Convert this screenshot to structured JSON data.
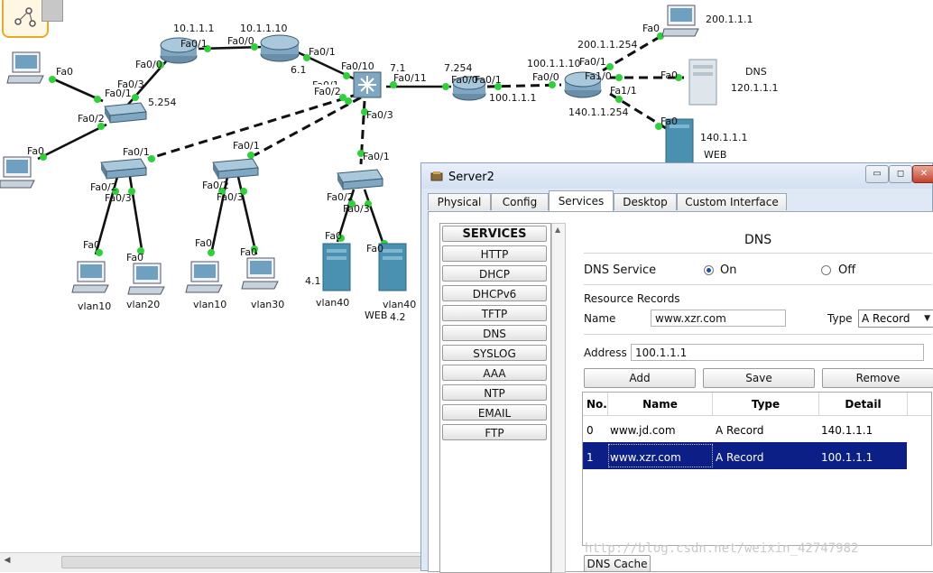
{
  "topology": {
    "labels": {
      "r1_ip": "10.1.1.1",
      "r2_ip": "10.1.1.10",
      "r1_fa01": "Fa0/1",
      "r2_fa00": "Fa0/0",
      "r1_fa00": "Fa0/0",
      "r2_fa01": "Fa0/1",
      "r2_sub": "6.1",
      "pc1_fa0": "Fa0",
      "sw1_fa01": "Fa0/1",
      "sw1_fa03": "Fa0/3",
      "sw1_ip": "5.254",
      "sw1_fa02": "Fa0/2",
      "pc2_fa0": "Fa0",
      "ms_fa010": "Fa0/10",
      "ms_ip": "7.1",
      "ms_fa011": "Fa0/11",
      "ms_fa02": "Fa0/2",
      "ms_fa01": "Fa0/1",
      "ms_fa03": "Fa0/3",
      "ra_ip": "7.254",
      "ra_fa0": "Fa0/0",
      "ra_fa01": "Fa0/1",
      "ra_ip2": "100.1.1.1",
      "rb_ip": "100.1.1.10",
      "rb_fa00": "Fa0/0",
      "rb_fa01": "Fa0/1",
      "rb_fa10": "Fa1/0",
      "rb_fa11": "Fa1/1",
      "rb_ip200": "200.1.1.254",
      "rb_ip140": "140.1.1.254",
      "pc200_fa0": "Fa0",
      "pc200_ip": "200.1.1.1",
      "dns_fa0": "Fa0",
      "dns_name": "DNS",
      "dns_ip": "120.1.1.1",
      "web_fa0": "Fa0",
      "web_ip": "140.1.1.1",
      "web_name": "WEB",
      "swa_fa01": "Fa0/1",
      "swa_fa02": "Fa0/2",
      "swa_fa03": "Fa0/3",
      "swb_fa01": "Fa0/1",
      "swb_fa02": "Fa0/2",
      "swb_fa03": "Fa0/3",
      "swc_fa01": "Fa0/1",
      "swc_fa02": "Fa0/2",
      "swc_fa03": "Fa0/3",
      "pa_fa0": "Fa0",
      "pa_name": "vlan10",
      "pb_fa0": "Fa0",
      "pb_name": "vlan20",
      "pc_fa0": "Fa0",
      "pc_name": "vlan10",
      "pd_fa0": "Fa0",
      "pd_name": "vlan30",
      "s1_fa0": "Fa0",
      "s1_ip": "4.1",
      "s1_name": "vlan40",
      "s2_fa0": "Fa0",
      "s2_name": "vlan40",
      "s2_web": "WEB",
      "s2_ip": "4.2"
    }
  },
  "window": {
    "title": "Server2",
    "controls": {
      "minimize": "▭",
      "maximize": "◻",
      "close": "✕"
    },
    "tabs": [
      "Physical",
      "Config",
      "Services",
      "Desktop",
      "Custom Interface"
    ],
    "active_tab": "Services",
    "services": [
      "SERVICES",
      "HTTP",
      "DHCP",
      "DHCPv6",
      "TFTP",
      "DNS",
      "SYSLOG",
      "AAA",
      "NTP",
      "EMAIL",
      "FTP"
    ],
    "dns": {
      "heading": "DNS",
      "service_label": "DNS Service",
      "on_label": "On",
      "off_label": "Off",
      "resource_records_label": "Resource Records",
      "name_label": "Name",
      "name_value": "www.xzr.com",
      "type_label": "Type",
      "type_value": "A Record",
      "address_label": "Address",
      "address_value": "100.1.1.1",
      "add_button": "Add",
      "save_button": "Save",
      "remove_button": "Remove",
      "table": {
        "headers": [
          "No.",
          "Name",
          "Type",
          "Detail"
        ],
        "rows": [
          [
            "0",
            "www.jd.com",
            "A Record",
            "140.1.1.1"
          ],
          [
            "1",
            "www.xzr.com",
            "A Record",
            "100.1.1.1"
          ]
        ],
        "selected_row": 1
      },
      "dns_cache_button": "DNS Cache"
    }
  },
  "watermark": "http://blog.csdn.net/weixin_42747982",
  "colors": {
    "link_dot": "#2fd13a",
    "selection": "#0b1f86",
    "device_blue": "#4a90b0"
  }
}
